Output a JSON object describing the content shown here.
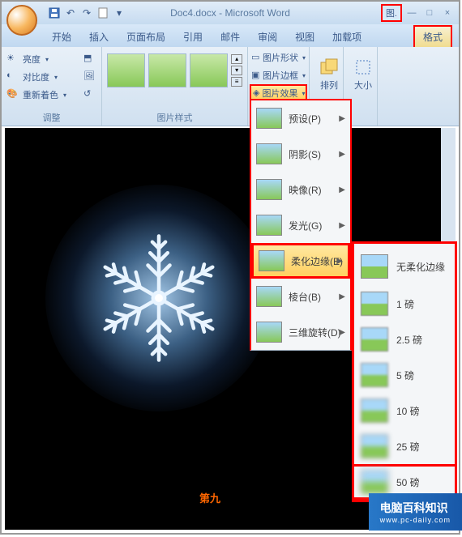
{
  "title": "Doc4.docx - Microsoft Word",
  "tool_tab_label": "图.",
  "tabs": {
    "home": "开始",
    "insert": "插入",
    "layout": "页面布局",
    "references": "引用",
    "mailings": "邮件",
    "review": "审阅",
    "view": "视图",
    "addins": "加载项",
    "format": "格式"
  },
  "ribbon": {
    "adjust": {
      "brightness": "亮度",
      "contrast": "对比度",
      "recolor": "重新着色",
      "group_label": "调整"
    },
    "styles": {
      "group_label": "图片样式"
    },
    "shape": {
      "shape": "图片形状",
      "border": "图片边框",
      "effects": "图片效果"
    },
    "arrange": {
      "label": "排列"
    },
    "size": {
      "label": "大小"
    }
  },
  "effects_menu": {
    "preset": "预设(P)",
    "shadow": "阴影(S)",
    "reflection": "映像(R)",
    "glow": "发光(G)",
    "soft_edges": "柔化边缘(E)",
    "bevel": "棱台(B)",
    "rotation_3d": "三维旋转(D)"
  },
  "soft_edges_submenu": {
    "none": "无柔化边缘",
    "pt1": "1 磅",
    "pt2_5": "2.5 磅",
    "pt5": "5 磅",
    "pt10": "10 磅",
    "pt25": "25 磅",
    "pt50": "50 磅"
  },
  "watermark": {
    "main": "电脑百科知识",
    "sub": "www.pc-daily.com",
    "small": "第九"
  }
}
